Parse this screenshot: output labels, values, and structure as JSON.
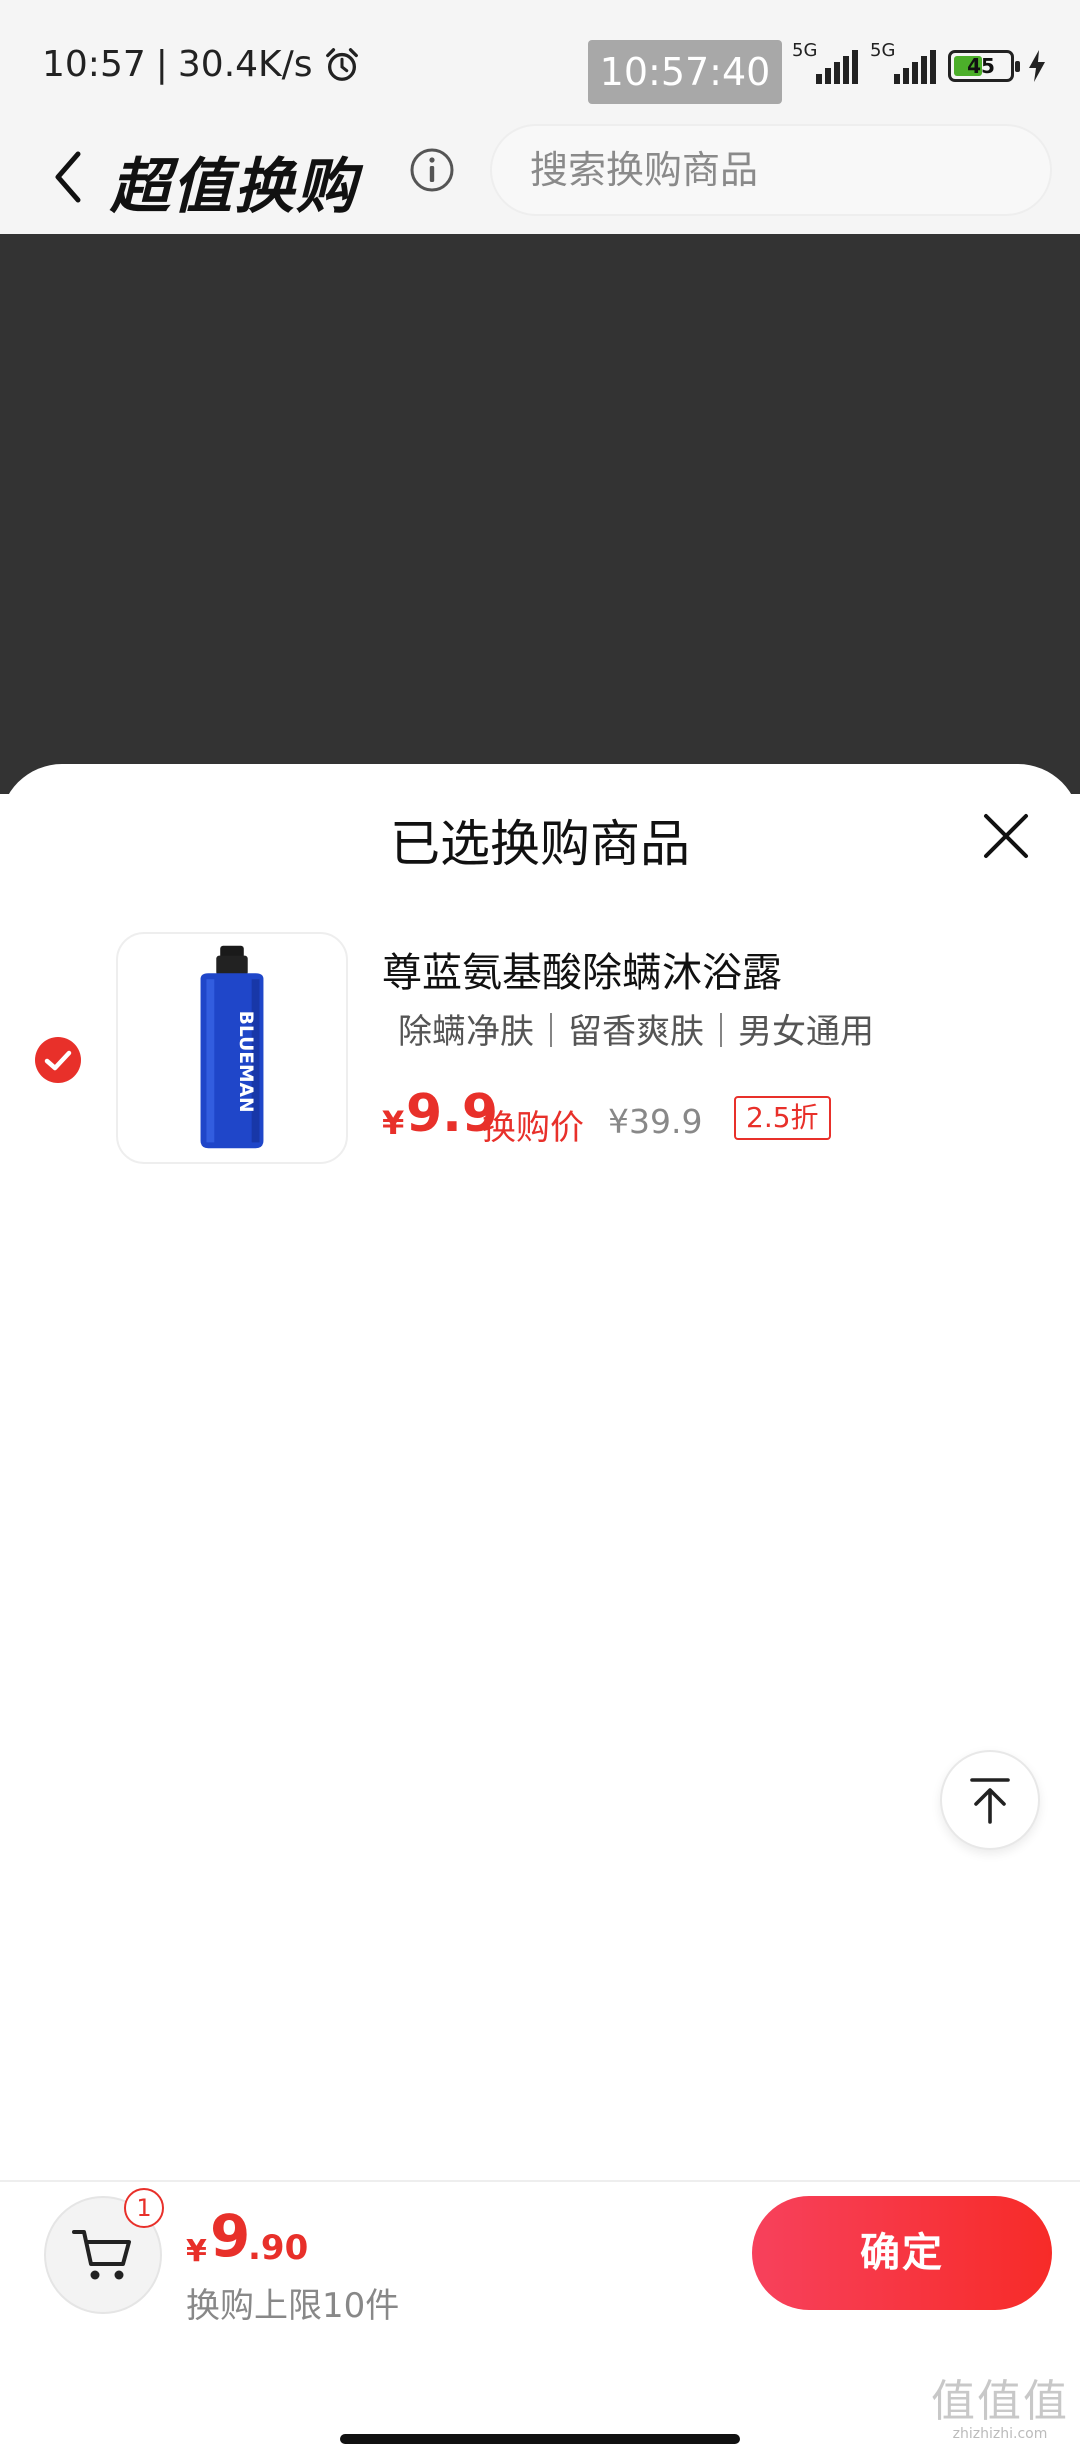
{
  "status_bar": {
    "time": "10:57",
    "network_speed": "30.4K/s",
    "overlay_time": "10:57:40",
    "sim_badge": "1 2",
    "net1": "5G",
    "net2": "5G",
    "battery": "45"
  },
  "header": {
    "title": "超值换购",
    "search_placeholder": "搜索换购商品"
  },
  "sheet": {
    "title": "已选换购商品",
    "item": {
      "name": "尊蓝氨基酸除螨沐浴露",
      "tags": "除螨净肤｜留香爽肤｜男女通用",
      "currency": "¥",
      "price": "9.9",
      "price_label": "换购价",
      "original_price": "¥39.9",
      "discount": "2.5折",
      "bottle_brand": "BLUEMAN",
      "selected": true
    }
  },
  "bottom_bar": {
    "cart_count": "1",
    "total_currency": "¥",
    "total_int": "9",
    "total_dec": ".90",
    "limit_text": "换购上限10件",
    "confirm_label": "确定"
  },
  "watermark": {
    "logo": "值值值",
    "url": "zhizhizhi.com"
  },
  "icons": {
    "alarm": "alarm-clock-icon",
    "back": "chevron-left-icon",
    "info": "info-circle-icon",
    "close": "close-icon",
    "check": "check-circle-icon",
    "back_to_top": "arrow-to-top-icon",
    "cart": "shopping-cart-icon",
    "charging": "bolt-icon"
  },
  "colors": {
    "accent": "#e8302a",
    "confirm_start": "#f7415c",
    "confirm_end": "#f72b28",
    "backdrop": "#333333",
    "header_bg": "#f5f5f5"
  }
}
